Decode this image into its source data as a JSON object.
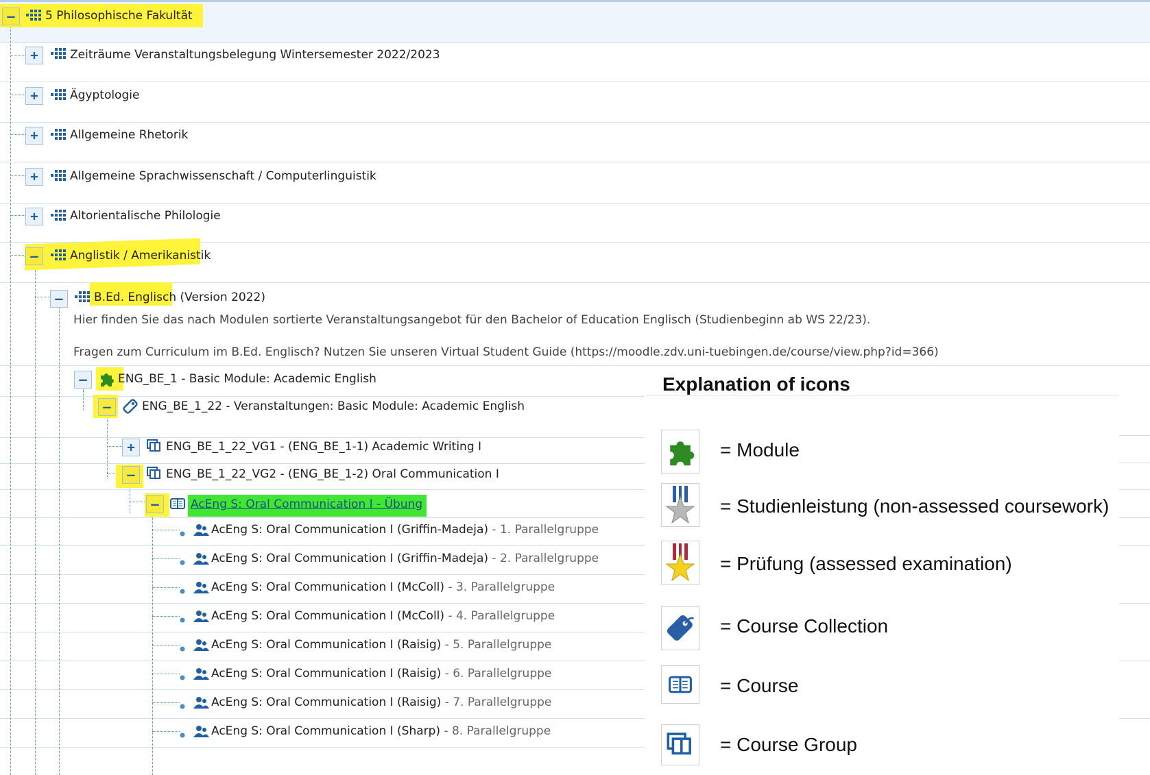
{
  "tree": {
    "root": {
      "label": "5 Philosophische Fakultät"
    },
    "level1": [
      {
        "label": "Zeiträume Veranstaltungsbelegung Wintersemester 2022/2023"
      },
      {
        "label": "Ägyptologie"
      },
      {
        "label": "Allgemeine Rhetorik"
      },
      {
        "label": "Allgemeine Sprachwissenschaft / Computerlinguistik"
      },
      {
        "label": "Altorientalische Philologie"
      },
      {
        "label": "Anglistik / Amerikanistik"
      }
    ],
    "program": {
      "label": "B.Ed. Englisch",
      "suffix": " (Version 2022)",
      "desc1": "Hier finden Sie das nach Modulen sortierte Veranstaltungsangebot für den Bachelor of Education Englisch (Studienbeginn ab WS 22/23).",
      "desc2": "Fragen zum Curriculum im B.Ed. Englisch? Nutzen Sie unseren Virtual Student Guide (https://moodle.zdv.uni-tuebingen.de/course/view.php?id=366)"
    },
    "module": {
      "label": "ENG_BE_1 - Basic Module: Academic English"
    },
    "collection": {
      "label": "ENG_BE_1_22 - Veranstaltungen: Basic Module: Academic English"
    },
    "groups": [
      {
        "label": "ENG_BE_1_22_VG1 - (ENG_BE_1-1) Academic Writing I"
      },
      {
        "label": "ENG_BE_1_22_VG2 - (ENG_BE_1-2) Oral Communication I"
      }
    ],
    "course": {
      "label": "AcEng S: Oral Communication I - Übung"
    },
    "parallel": [
      {
        "name": "AcEng S: Oral Communication I (Griffin-Madeja)",
        "group": " - 1. Parallelgruppe"
      },
      {
        "name": "AcEng S: Oral Communication I (Griffin-Madeja)",
        "group": " - 2. Parallelgruppe"
      },
      {
        "name": "AcEng S: Oral Communication I (McColl)",
        "group": " - 3. Parallelgruppe"
      },
      {
        "name": "AcEng S: Oral Communication I (McColl)",
        "group": " - 4. Parallelgruppe"
      },
      {
        "name": "AcEng S: Oral Communication I (Raisig)",
        "group": " - 5. Parallelgruppe"
      },
      {
        "name": "AcEng S: Oral Communication I (Raisig)",
        "group": " - 6. Parallelgruppe"
      },
      {
        "name": "AcEng S: Oral Communication I (Raisig)",
        "group": " - 7. Parallelgruppe"
      },
      {
        "name": "AcEng S: Oral Communication I (Sharp)",
        "group": " - 8. Parallelgruppe"
      }
    ]
  },
  "legend": {
    "title": "Explanation of icons",
    "items": [
      {
        "icon": "module-puzzle-icon",
        "text": "= Module"
      },
      {
        "icon": "studienleistung-medal-icon",
        "text": "= Studienleistung (non-assessed coursework)"
      },
      {
        "icon": "pruefung-medal-icon",
        "text": "= Prüfung (assessed examination)"
      },
      {
        "icon": "course-collection-tag-icon",
        "text": "= Course Collection"
      },
      {
        "icon": "course-book-icon",
        "text": "= Course"
      },
      {
        "icon": "course-group-books-icon",
        "text": "= Course Group"
      }
    ]
  },
  "colors": {
    "highlight_yellow": "#fff43a",
    "highlight_green": "#41e632",
    "tree_blue": "#1f5fa3",
    "module_green": "#2e8b22"
  }
}
